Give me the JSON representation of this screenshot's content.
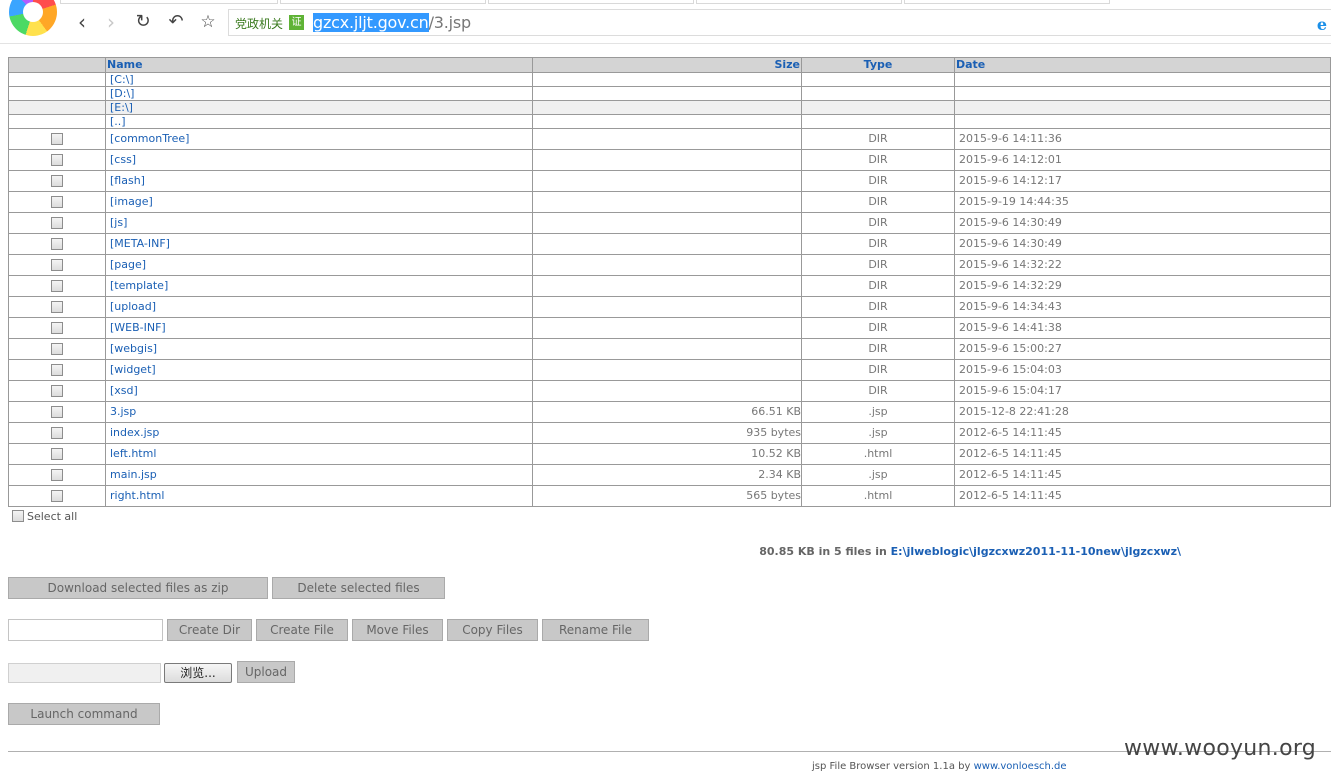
{
  "browser": {
    "site_tag": "党政机关",
    "cert_badge": "证",
    "url_host": "gzcx.jljt.gov.cn",
    "url_path": "/3.jsp",
    "ie_glyph": "e"
  },
  "table": {
    "headers": {
      "name": "Name",
      "size": "Size",
      "type": "Type",
      "date": "Date"
    },
    "drives": [
      "[C:\\]",
      "[D:\\]",
      "[E:\\]",
      "[..]"
    ],
    "rows": [
      {
        "name": "[commonTree]",
        "size": "",
        "type": "DIR",
        "date": "2015-9-6 14:11:36"
      },
      {
        "name": "[css]",
        "size": "",
        "type": "DIR",
        "date": "2015-9-6 14:12:01"
      },
      {
        "name": "[flash]",
        "size": "",
        "type": "DIR",
        "date": "2015-9-6 14:12:17"
      },
      {
        "name": "[image]",
        "size": "",
        "type": "DIR",
        "date": "2015-9-19 14:44:35"
      },
      {
        "name": "[js]",
        "size": "",
        "type": "DIR",
        "date": "2015-9-6 14:30:49"
      },
      {
        "name": "[META-INF]",
        "size": "",
        "type": "DIR",
        "date": "2015-9-6 14:30:49"
      },
      {
        "name": "[page]",
        "size": "",
        "type": "DIR",
        "date": "2015-9-6 14:32:22"
      },
      {
        "name": "[template]",
        "size": "",
        "type": "DIR",
        "date": "2015-9-6 14:32:29"
      },
      {
        "name": "[upload]",
        "size": "",
        "type": "DIR",
        "date": "2015-9-6 14:34:43"
      },
      {
        "name": "[WEB-INF]",
        "size": "",
        "type": "DIR",
        "date": "2015-9-6 14:41:38"
      },
      {
        "name": "[webgis]",
        "size": "",
        "type": "DIR",
        "date": "2015-9-6 15:00:27"
      },
      {
        "name": "[widget]",
        "size": "",
        "type": "DIR",
        "date": "2015-9-6 15:04:03"
      },
      {
        "name": "[xsd]",
        "size": "",
        "type": "DIR",
        "date": "2015-9-6 15:04:17"
      },
      {
        "name": "3.jsp",
        "size": "66.51 KB",
        "type": ".jsp",
        "date": "2015-12-8 22:41:28"
      },
      {
        "name": "index.jsp",
        "size": "935 bytes",
        "type": ".jsp",
        "date": "2012-6-5 14:11:45"
      },
      {
        "name": "left.html",
        "size": "10.52 KB",
        "type": ".html",
        "date": "2012-6-5 14:11:45"
      },
      {
        "name": "main.jsp",
        "size": "2.34 KB",
        "type": ".jsp",
        "date": "2012-6-5 14:11:45"
      },
      {
        "name": "right.html",
        "size": "565 bytes",
        "type": ".html",
        "date": "2012-6-5 14:11:45"
      }
    ]
  },
  "select_all_label": "Select all",
  "summary": {
    "text": "80.85 KB in 5 files in ",
    "path": "E:\\jlweblogic\\jlgzcxwz2011-11-10new\\jlgzcxwz\\"
  },
  "actions": {
    "download_zip": "Download selected files as zip",
    "delete_selected": "Delete selected files",
    "create_dir": "Create Dir",
    "create_file": "Create File",
    "move_files": "Move Files",
    "copy_files": "Copy Files",
    "rename_file": "Rename File",
    "browse": "浏览...",
    "upload": "Upload",
    "launch_command": "Launch command"
  },
  "footer": {
    "text": "jsp File Browser version 1.1a by ",
    "link": "www.vonloesch.de"
  },
  "watermark": "www.wooyun.org"
}
